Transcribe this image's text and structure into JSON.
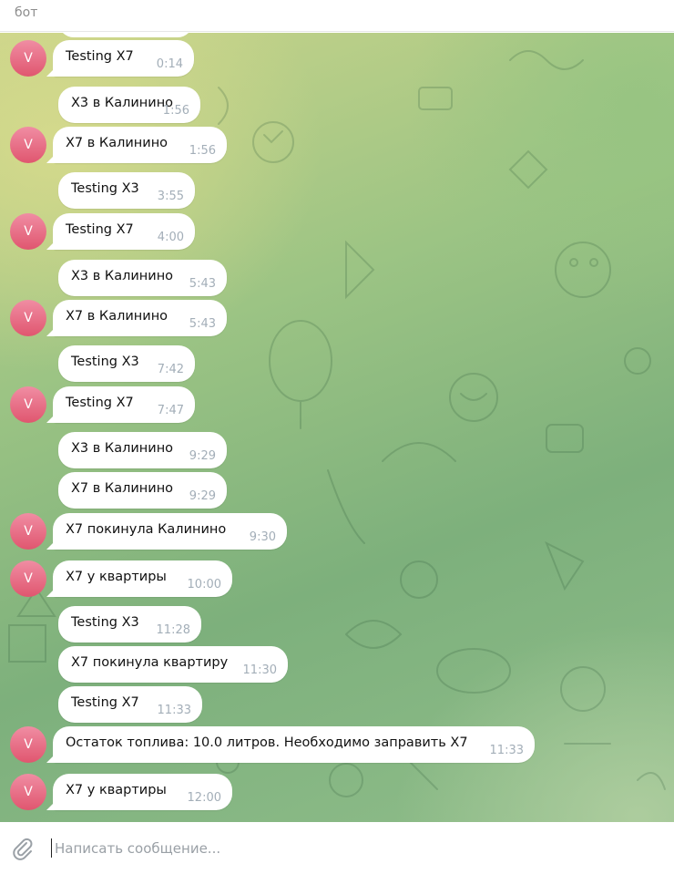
{
  "header": {
    "title": "бот"
  },
  "avatar_letter": "V",
  "composer": {
    "placeholder": "Написать сообщение..."
  },
  "messages": [
    {
      "text": "Testing X7",
      "time": "0:14"
    },
    {
      "text": "X3 в Калинино",
      "time": "1:56"
    },
    {
      "text": "X7 в Калинино",
      "time": "1:56"
    },
    {
      "text": "Testing X3",
      "time": "3:55"
    },
    {
      "text": "Testing X7",
      "time": "4:00"
    },
    {
      "text": "X3 в Калинино",
      "time": "5:43"
    },
    {
      "text": "X7 в Калинино",
      "time": "5:43"
    },
    {
      "text": "Testing X3",
      "time": "7:42"
    },
    {
      "text": "Testing X7",
      "time": "7:47"
    },
    {
      "text": "X3 в Калинино",
      "time": "9:29"
    },
    {
      "text": "X7 в Калинино",
      "time": "9:29"
    },
    {
      "text": "X7 покинула Калинино",
      "time": "9:30"
    },
    {
      "text": "X7 у квартиры",
      "time": "10:00"
    },
    {
      "text": "Testing X3",
      "time": "11:28"
    },
    {
      "text": "X7 покинула квартиру",
      "time": "11:30"
    },
    {
      "text": "Testing X7",
      "time": "11:33"
    },
    {
      "text": "Остаток топлива: 10.0 литров. Необходимо заправить X7",
      "time": "11:33"
    },
    {
      "text": "X7 у квартиры",
      "time": "12:00"
    }
  ]
}
